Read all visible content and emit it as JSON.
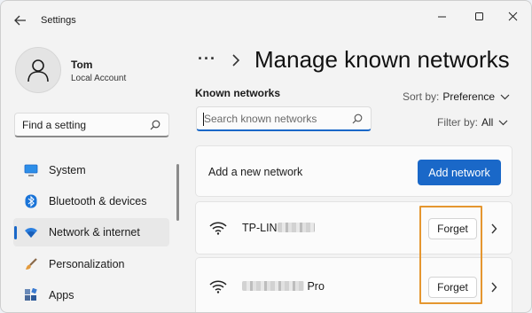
{
  "window": {
    "title": "Settings"
  },
  "user": {
    "name": "Tom",
    "account_type": "Local Account"
  },
  "sidebar": {
    "search_placeholder": "Find a setting",
    "items": [
      {
        "label": "System",
        "icon": "monitor-icon",
        "active": false
      },
      {
        "label": "Bluetooth & devices",
        "icon": "bluetooth-icon",
        "active": false
      },
      {
        "label": "Network & internet",
        "icon": "wifi-icon",
        "active": true
      },
      {
        "label": "Personalization",
        "icon": "paintbrush-icon",
        "active": false
      },
      {
        "label": "Apps",
        "icon": "apps-icon",
        "active": false
      }
    ]
  },
  "header": {
    "breadcrumb_more": "···",
    "page_title": "Manage known networks"
  },
  "known_networks": {
    "section_label": "Known networks",
    "search_placeholder": "Search known networks",
    "sort_label": "Sort by:",
    "sort_value": "Preference",
    "filter_label": "Filter by:",
    "filter_value": "All"
  },
  "add_network": {
    "label": "Add a new network",
    "button": "Add network"
  },
  "networks": [
    {
      "name_visible_prefix": "TP-LIN",
      "name_visible_suffix": "",
      "forget_label": "Forget"
    },
    {
      "name_visible_prefix": "",
      "name_visible_suffix": " Pro",
      "forget_label": "Forget"
    }
  ],
  "colors": {
    "accent": "#1a68c8",
    "highlight_box": "#e5962f",
    "window_bg": "#f3f3f3",
    "card_bg": "#fbfbfb"
  }
}
